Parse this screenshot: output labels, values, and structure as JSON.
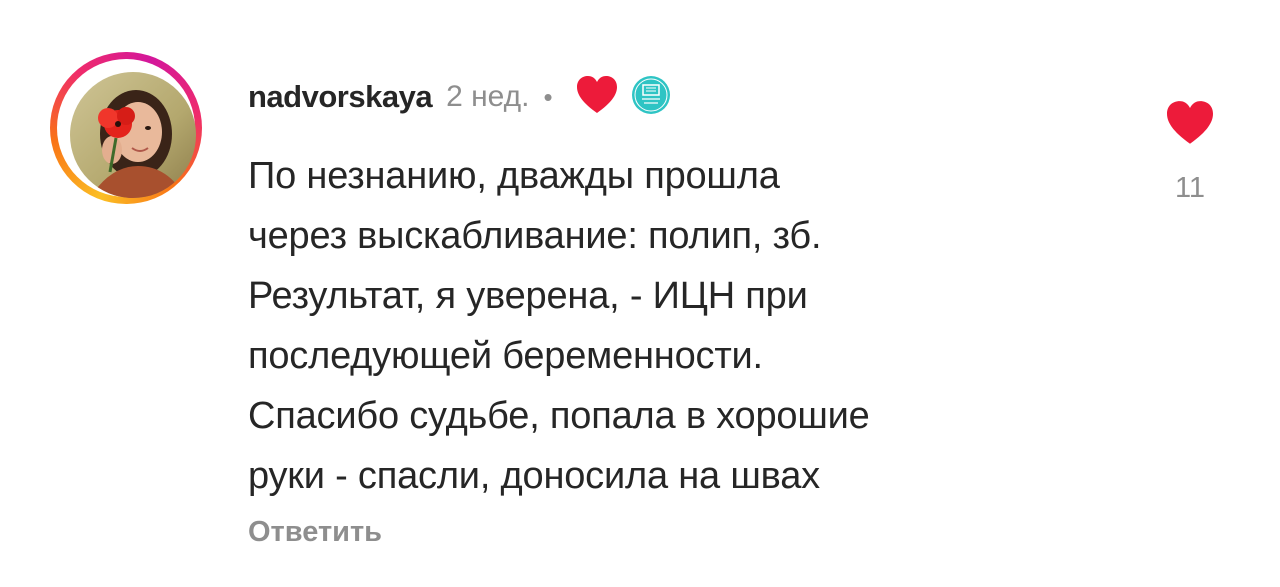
{
  "comment": {
    "username": "nadvorskaya",
    "time": "2 нед.",
    "separator": "•",
    "author_liked_icon": "red-heart-icon",
    "badge_icon": "evi-clinic-logo-icon",
    "text_lines": [
      "По незнанию, дважды прошла",
      "через выскабливание: полип, зб.",
      "Результат, я уверена, - ИЦН при",
      "последующей беременности.",
      "Спасибо судьбе, попала в хорошие",
      "руки - спасли, доносила на швах"
    ],
    "reply_label": "Ответить",
    "like_icon": "heart-icon",
    "like_count": "11"
  },
  "colors": {
    "heart": "#ed1b3a",
    "badge": "#2ec4c4",
    "secondary_text": "#8e8e8e",
    "primary_text": "#262626"
  }
}
